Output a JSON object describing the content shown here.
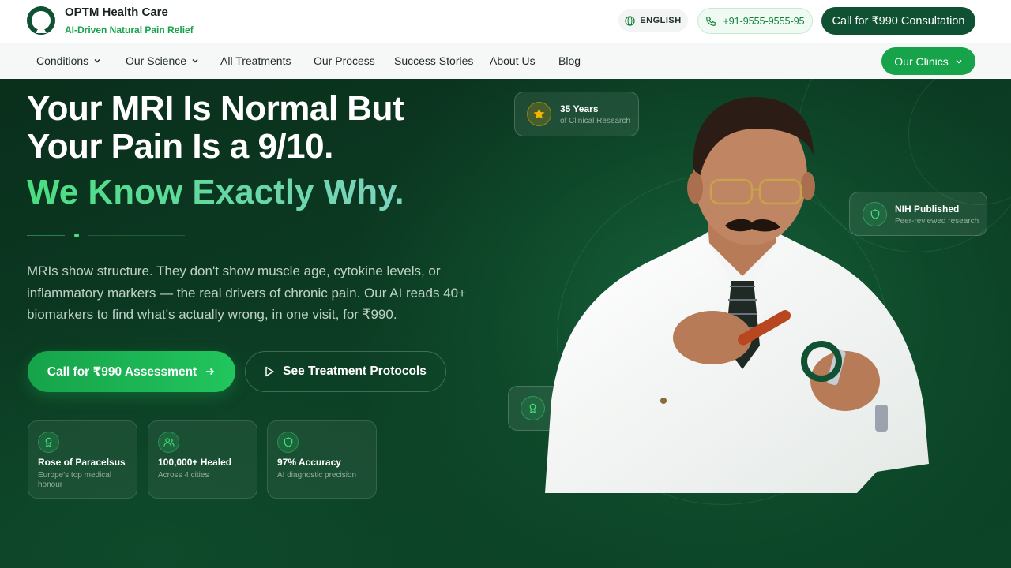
{
  "header": {
    "brand_name": "OPTM Health Care",
    "brand_tagline": "AI-Driven Natural Pain Relief",
    "language": "ENGLISH",
    "phone": "+91-9555-9555-95",
    "cta": "Call for ₹990 Consultation"
  },
  "nav": {
    "items": [
      "Conditions",
      "Our Science",
      "All Treatments",
      "Our Process",
      "Success Stories",
      "About Us",
      "Blog"
    ],
    "clinics": "Our Clinics"
  },
  "hero": {
    "headline_line1": "Your MRI Is Normal But",
    "headline_line2": "Your Pain Is a 9/10.",
    "headline_accent": "We Know Exactly Why.",
    "description": "MRIs show structure. They don't show muscle age, cytokine levels, or inflammatory markers — the real drivers of chronic pain. Our AI reads 40+ biomarkers to find what's actually wrong, in one visit, for ₹990.",
    "cta_primary": "Call for ₹990 Assessment",
    "cta_secondary": "See Treatment Protocols"
  },
  "stats": [
    {
      "title": "Rose of Paracelsus",
      "subtitle": "Europe's top medical honour",
      "icon": "award-icon"
    },
    {
      "title": "100,000+ Healed",
      "subtitle": "Across 4 cities",
      "icon": "users-icon"
    },
    {
      "title": "97% Accuracy",
      "subtitle": "AI diagnostic precision",
      "icon": "shield-icon"
    }
  ],
  "badges": {
    "years_title": "35 Years",
    "years_sub": "of Clinical Research",
    "nih_title": "NIH Published",
    "nih_sub": "Peer-reviewed research"
  },
  "colors": {
    "brand_dark": "#0f5132",
    "brand_green": "#16a34a",
    "accent_text": "#4ade80",
    "hero_bg": "#0b3a22",
    "star": "#f5b400"
  }
}
